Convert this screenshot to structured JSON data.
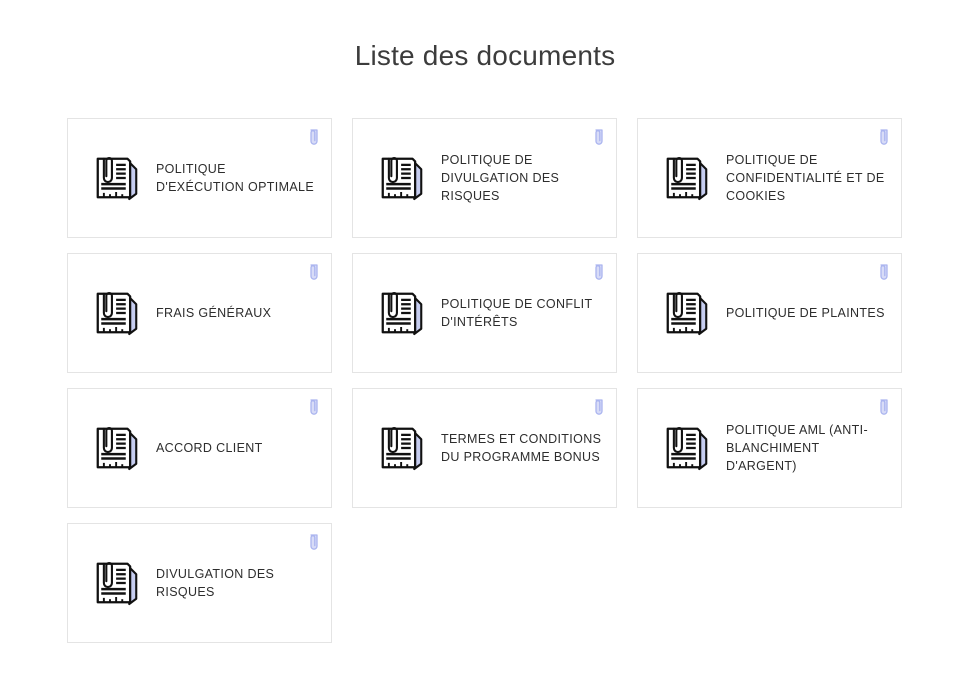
{
  "page": {
    "title": "Liste des documents",
    "background_color": "#ffffff",
    "title_color": "#3c3c3c",
    "card_border_color": "#e4e4e4",
    "label_color": "#2d2d2d",
    "accent_color": "#aab4ef",
    "icon_page_color": "#c6cdf0"
  },
  "documents": [
    {
      "label": "POLITIQUE D'EXÉCUTION OPTIMALE",
      "icon": "document-paperclip-icon",
      "badge_icon": "paperclip-icon"
    },
    {
      "label": "POLITIQUE DE DIVULGATION DES RISQUES",
      "icon": "document-paperclip-icon",
      "badge_icon": "paperclip-icon"
    },
    {
      "label": "POLITIQUE DE CONFIDENTIALITÉ ET DE COOKIES",
      "icon": "document-paperclip-icon",
      "badge_icon": "paperclip-icon"
    },
    {
      "label": "FRAIS GÉNÉRAUX",
      "icon": "document-paperclip-icon",
      "badge_icon": "paperclip-icon"
    },
    {
      "label": "POLITIQUE DE CONFLIT D'INTÉRÊTS",
      "icon": "document-paperclip-icon",
      "badge_icon": "paperclip-icon"
    },
    {
      "label": "POLITIQUE DE PLAINTES",
      "icon": "document-paperclip-icon",
      "badge_icon": "paperclip-icon"
    },
    {
      "label": "ACCORD CLIENT",
      "icon": "document-paperclip-icon",
      "badge_icon": "paperclip-icon"
    },
    {
      "label": "TERMES ET CONDITIONS DU PROGRAMME BONUS",
      "icon": "document-paperclip-icon",
      "badge_icon": "paperclip-icon"
    },
    {
      "label": "POLITIQUE AML (ANTI-BLANCHIMENT D'ARGENT)",
      "icon": "document-paperclip-icon",
      "badge_icon": "paperclip-icon"
    },
    {
      "label": "DIVULGATION DES RISQUES",
      "icon": "document-paperclip-icon",
      "badge_icon": "paperclip-icon"
    }
  ]
}
